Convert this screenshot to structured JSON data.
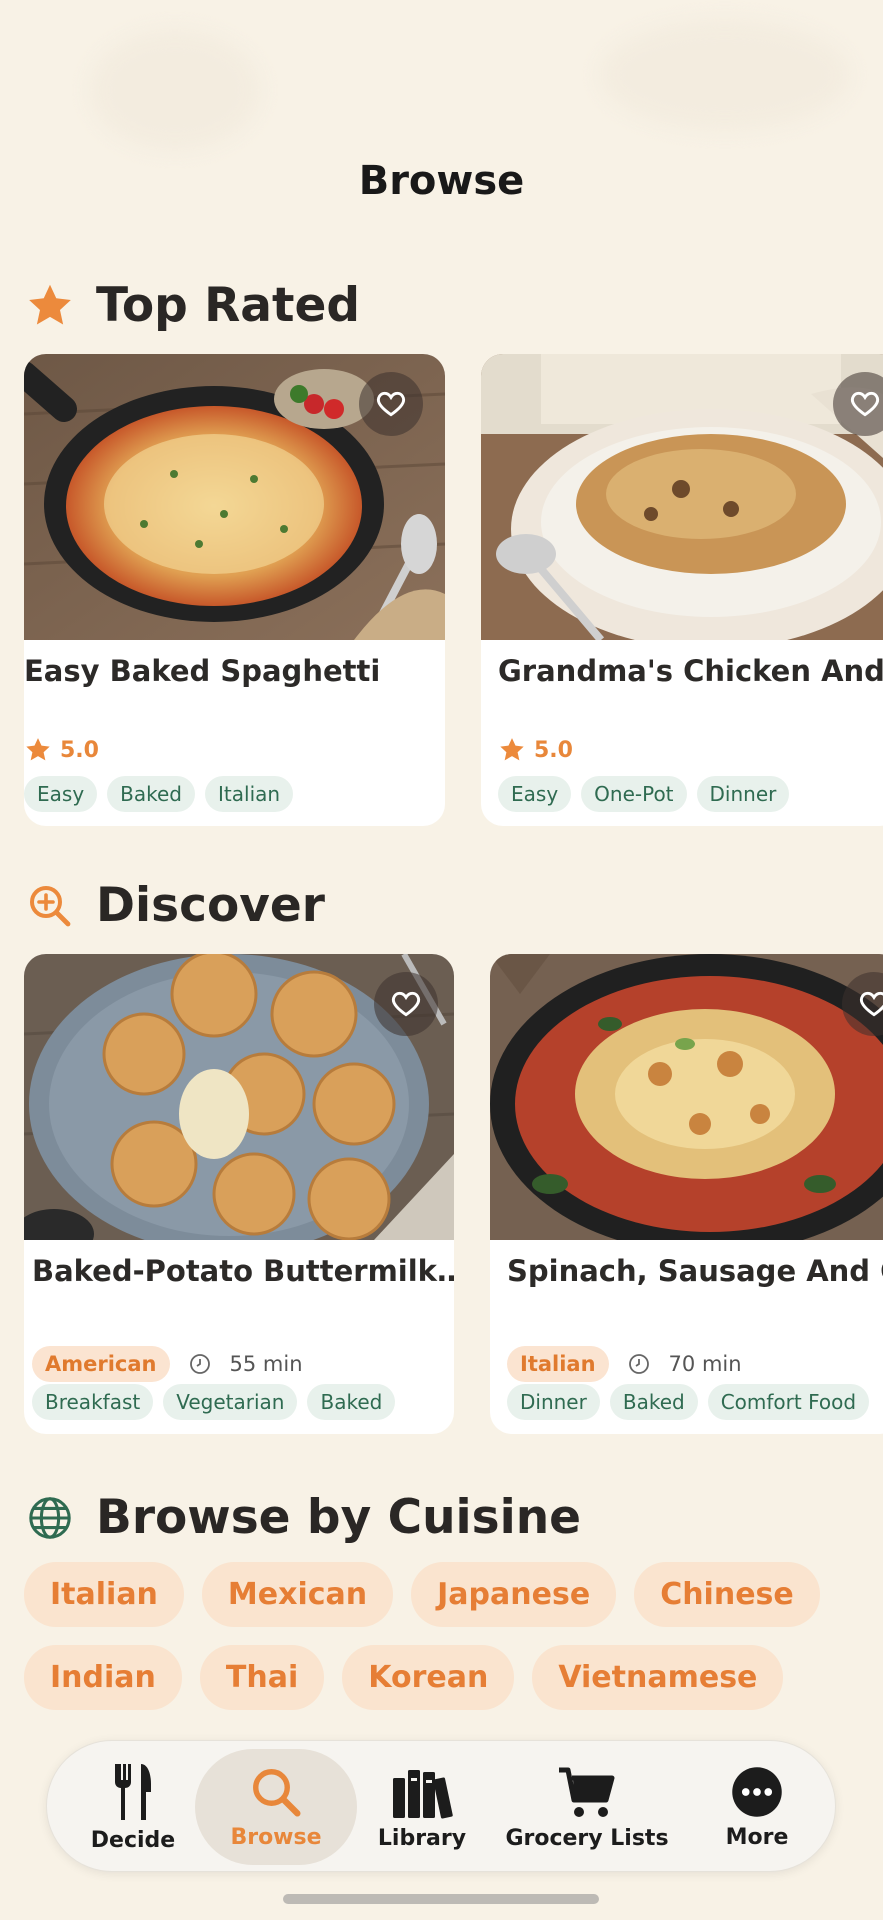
{
  "header": {
    "title": "Browse"
  },
  "top_rated": {
    "title": "Top Rated",
    "cards": [
      {
        "name": "Easy Baked Spaghetti",
        "rating": "5.0",
        "tags": [
          "Easy",
          "Baked",
          "Italian"
        ]
      },
      {
        "name": "Grandma's Chicken And I",
        "rating": "5.0",
        "tags": [
          "Easy",
          "One-Pot",
          "Dinner"
        ]
      }
    ]
  },
  "discover": {
    "title": "Discover",
    "cards": [
      {
        "name": "Baked-Potato Buttermilk…",
        "cuisine": "American",
        "time": "55 min",
        "tags": [
          "Breakfast",
          "Vegetarian",
          "Baked"
        ]
      },
      {
        "name": "Spinach, Sausage And C",
        "cuisine": "Italian",
        "time": "70 min",
        "tags": [
          "Dinner",
          "Baked",
          "Comfort Food"
        ]
      }
    ]
  },
  "browse_by_cuisine": {
    "title": "Browse by Cuisine",
    "rows": [
      [
        "Italian",
        "Mexican",
        "Japanese",
        "Chinese"
      ],
      [
        "Indian",
        "Thai",
        "Korean",
        "Vietnamese"
      ]
    ]
  },
  "tabbar": {
    "tabs": [
      {
        "label": "Decide",
        "icon": "fork-knife-icon"
      },
      {
        "label": "Browse",
        "icon": "search-icon"
      },
      {
        "label": "Library",
        "icon": "books-icon"
      },
      {
        "label": "Grocery Lists",
        "icon": "cart-icon"
      },
      {
        "label": "More",
        "icon": "more-icon"
      }
    ],
    "active": "Browse"
  },
  "colors": {
    "accent": "#e8873a",
    "background": "#f8f2e6",
    "tag_bg": "#e8f1ec",
    "tag_text": "#2f6b51"
  }
}
